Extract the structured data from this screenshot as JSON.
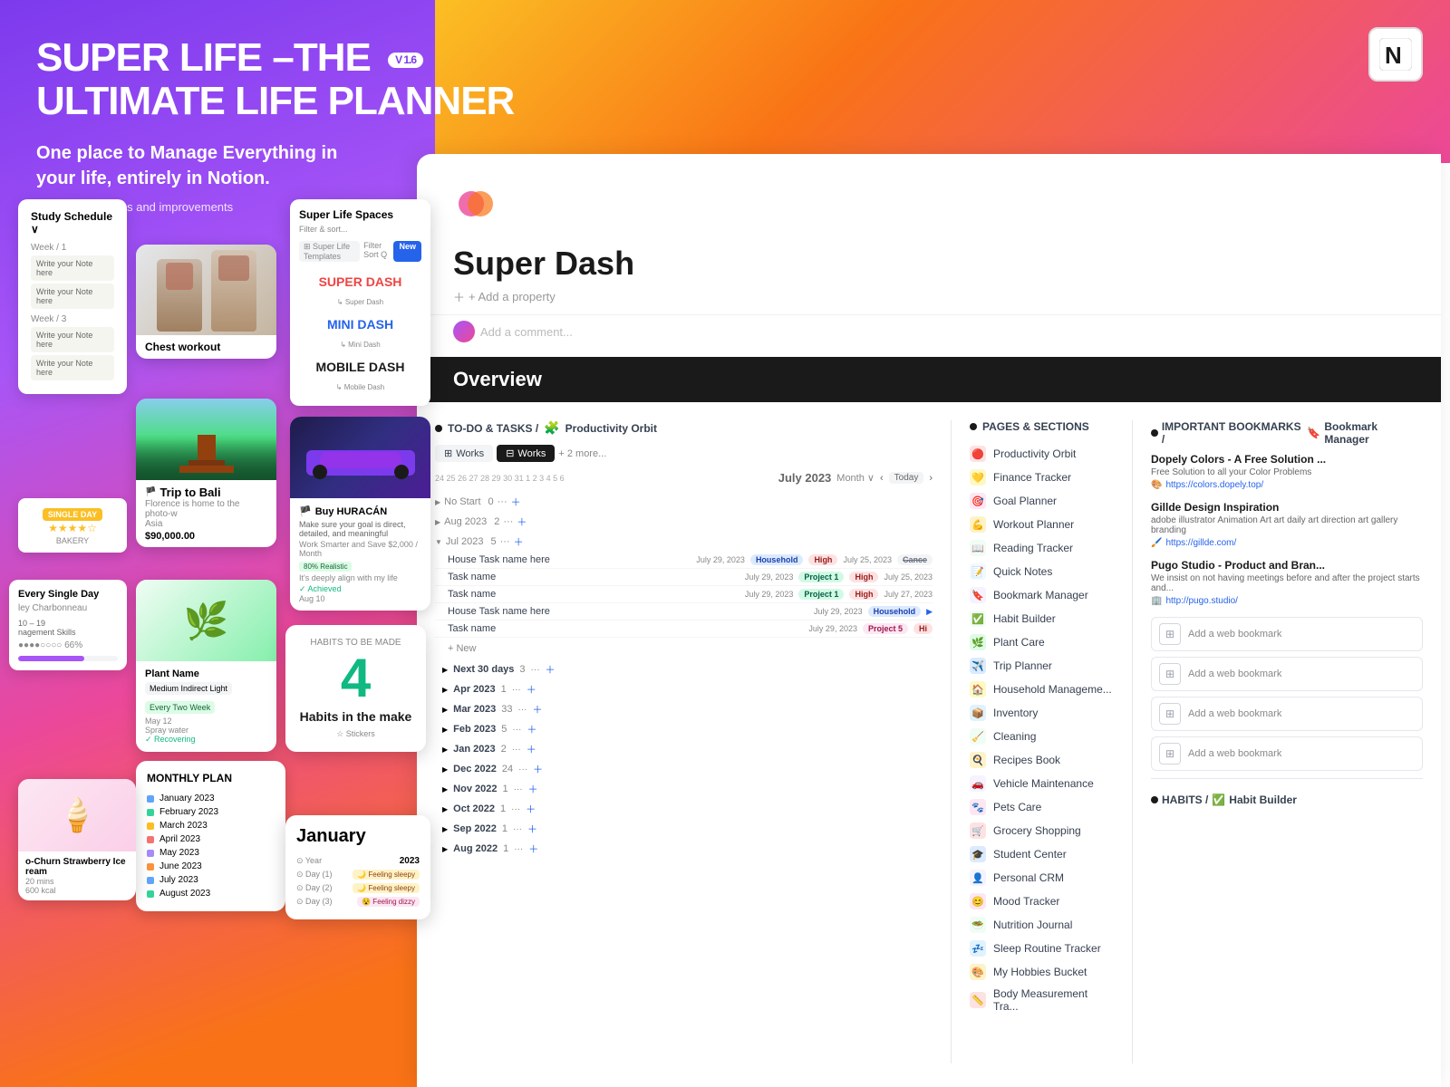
{
  "header": {
    "title_line1": "SUPER LIFE –THE",
    "title_line2": "ULTIMATE LIFE PLANNER",
    "version": "V 1.6",
    "subtitle": "One place to Manage Everything in your life, entirely in Notion.",
    "update_note": "+ Regular updates and improvements"
  },
  "spaces_card": {
    "title": "Super Life Spaces",
    "subtitle": "Filter & sort...",
    "items": [
      {
        "label": "SUPER DASH",
        "color": "red"
      },
      {
        "sublabel": "↳ Super Dash"
      },
      {
        "label": "MINI DASH",
        "color": "blue"
      },
      {
        "sublabel": "↳ Mini Dash"
      },
      {
        "label": "MOBILE DASH",
        "color": "black"
      },
      {
        "sublabel": "↳ Mobile Dash"
      }
    ]
  },
  "chest_card": {
    "label": "Chest workout"
  },
  "bali_card": {
    "title": "Trip to Bali",
    "subtitle": "Florence is home to the photo-w",
    "region": "Asia",
    "price": "$90,000.00"
  },
  "study_card": {
    "title": "Study Schedule",
    "notes": [
      "Write your Note here",
      "Write your Note here",
      "Write your Note here",
      "Write your Note here"
    ],
    "weeks": [
      "Week / 1",
      "Week / 3"
    ]
  },
  "plant_card": {
    "name": "Plant Name",
    "tag": "Medium Indirect Light",
    "schedule": "Every Two Week",
    "date": "May 12"
  },
  "daily_card": {
    "title": "Every Single Day",
    "person": "ley Charbonneau",
    "range": "10 – 19",
    "skills": "nagement Skills",
    "progress": 66
  },
  "habits_card": {
    "number": "4",
    "title": "Habits in the make",
    "stickers": "☆ Stickers"
  },
  "car_card": {
    "flag": "🏴",
    "title": "Buy HURACÁN",
    "desc": "Make sure your goal is direct, detailed, and meaningful",
    "tagline": "Work Smarter and Save $2,000 / Month",
    "achievement": "✓ Achieved",
    "date": "Aug 10"
  },
  "monthly_card": {
    "title": "MONTHLY PLAN",
    "months": [
      {
        "name": "January 2023",
        "color": "#60a5fa"
      },
      {
        "name": "February 2023",
        "color": "#34d399"
      },
      {
        "name": "March 2023",
        "color": "#fbbf24"
      },
      {
        "name": "April 2023",
        "color": "#f87171"
      },
      {
        "name": "May 2023",
        "color": "#a78bfa"
      },
      {
        "name": "June 2023",
        "color": "#fb923c"
      },
      {
        "name": "July 2023",
        "color": "#60a5fa"
      },
      {
        "name": "August 2023",
        "color": "#34d399"
      }
    ]
  },
  "icecream_card": {
    "name": "o-Churn Strawberry Ice ream",
    "time": "20 mins",
    "kcal": "600 kcal"
  },
  "january_card": {
    "title": "January",
    "fields": [
      {
        "label": "Year",
        "value": "2023"
      },
      {
        "label": "Day (1)",
        "value": "🌙 Feeling sleepy"
      },
      {
        "label": "Day (2)",
        "value": "🌙 Feeling sleepy"
      },
      {
        "label": "Day (3)",
        "value": "😵 Feeling dizzy"
      }
    ]
  },
  "notion_page": {
    "title": "Super Dash",
    "add_property": "+ Add a property",
    "add_comment": "Add a comment...",
    "overview_label": "Overview"
  },
  "todo_section": {
    "label": "TO-DO & TASKS /",
    "sublabel": "Productivity Orbit",
    "tabs": [
      "Works",
      "Works",
      "+ 2 more..."
    ],
    "month": "July 2023",
    "view_label": "Month",
    "today_label": "Today",
    "calendar_nums": [
      "24",
      "25",
      "26",
      "27",
      "28",
      "29",
      "30",
      "31",
      "1",
      "2",
      "3",
      "4",
      "5",
      "6"
    ],
    "no_start": "No Start",
    "periods": [
      {
        "label": "Aug 2023",
        "count": "2"
      },
      {
        "label": "Jul 2023",
        "count": "5"
      }
    ],
    "tasks": [
      {
        "name": "House Task name here",
        "date": "July 29, 2023",
        "tag1": "Household",
        "tag2": "High",
        "date2": "July 25, 2023",
        "tag3": "Cance"
      },
      {
        "name": "Task name",
        "date": "July 29, 2023",
        "tag1": "Project 1",
        "tag2": "High",
        "date2": "July 25, 2023",
        "tag3": ""
      },
      {
        "name": "Task name",
        "date": "July 29, 2023",
        "tag1": "Project 1",
        "tag2": "High",
        "date2": "July 27, 2023",
        "tag3": ""
      },
      {
        "name": "House Task name here",
        "date": "July 29, 2023",
        "tag1": "Household",
        "tag2": "",
        "date2": "",
        "tag3": ""
      },
      {
        "name": "Task name",
        "date": "July 29, 2023",
        "tag1": "Project 5",
        "tag2": "Hi",
        "date2": "",
        "tag3": ""
      }
    ],
    "new_label": "+ New",
    "more_periods": [
      {
        "label": "Next 30 days",
        "count": "3"
      },
      {
        "label": "Apr 2023",
        "count": "1"
      },
      {
        "label": "Mar 2023",
        "count": "33"
      },
      {
        "label": "Feb 2023",
        "count": "5"
      },
      {
        "label": "Jan 2023",
        "count": "2"
      },
      {
        "label": "Dec 2022",
        "count": "24"
      },
      {
        "label": "Nov 2022",
        "count": "1"
      },
      {
        "label": "Oct 2022",
        "count": "1"
      },
      {
        "label": "Sep 2022",
        "count": "1"
      },
      {
        "label": "Aug 2022",
        "count": "1"
      }
    ]
  },
  "pages_section": {
    "label": "PAGES & SECTIONS",
    "items": [
      {
        "emoji": "🔴",
        "name": "Productivity Orbit"
      },
      {
        "emoji": "🟡",
        "name": "Finance Tracker"
      },
      {
        "emoji": "🎯",
        "name": "Goal Planner"
      },
      {
        "emoji": "💪",
        "name": "Workout Planner"
      },
      {
        "emoji": "📖",
        "name": "Reading Tracker"
      },
      {
        "emoji": "📝",
        "name": "Quick Notes"
      },
      {
        "emoji": "🔖",
        "name": "Bookmark Manager"
      },
      {
        "emoji": "✅",
        "name": "Habit Builder"
      },
      {
        "emoji": "🌿",
        "name": "Plant Care"
      },
      {
        "emoji": "✈️",
        "name": "Trip Planner"
      },
      {
        "emoji": "🏠",
        "name": "Household Manageme..."
      },
      {
        "emoji": "📦",
        "name": "Inventory"
      },
      {
        "emoji": "🧹",
        "name": "Cleaning"
      },
      {
        "emoji": "🍳",
        "name": "Recipes Book"
      },
      {
        "emoji": "🚗",
        "name": "Vehicle Maintenance"
      },
      {
        "emoji": "🐾",
        "name": "Pets Care"
      },
      {
        "emoji": "🛒",
        "name": "Grocery Shopping"
      },
      {
        "emoji": "🎓",
        "name": "Student Center"
      },
      {
        "emoji": "👤",
        "name": "Personal CRM"
      },
      {
        "emoji": "😊",
        "name": "Mood Tracker"
      },
      {
        "emoji": "🥗",
        "name": "Nutrition Journal"
      },
      {
        "emoji": "💤",
        "name": "Sleep Routine Tracker"
      },
      {
        "emoji": "🎨",
        "name": "My Hobbies Bucket"
      },
      {
        "emoji": "📏",
        "name": "Body Measurement Tra..."
      }
    ]
  },
  "bookmarks_section": {
    "label": "IMPORTANT BOOKMARKS /",
    "sublabel": "Bookmark Manager",
    "items": [
      {
        "title": "Dopely Colors - A Free Solution ...",
        "desc": "Free Solution to all your Color Problems",
        "link": "https://colors.dopely.top/",
        "icon": "🎨"
      },
      {
        "title": "Gillde Design Inspiration",
        "desc": "adobe illustrator Animation Art art daily art direction art gallery branding",
        "link": "https://gillde.com/",
        "icon": "🖌️"
      },
      {
        "title": "Pugo Studio - Product and Bran...",
        "desc": "We insist on not having meetings before and after the project starts and...",
        "link": "http://pugo.studio/",
        "icon": "🏢"
      }
    ],
    "add_bookmarks": [
      "Add a web bookmark",
      "Add a web bookmark",
      "Add a web bookmark",
      "Add a web bookmark"
    ]
  },
  "habits_bottom": {
    "label": "HABITS /",
    "sublabel": "Habit Builder"
  },
  "mood_tracker_label": "Mood Tracker"
}
